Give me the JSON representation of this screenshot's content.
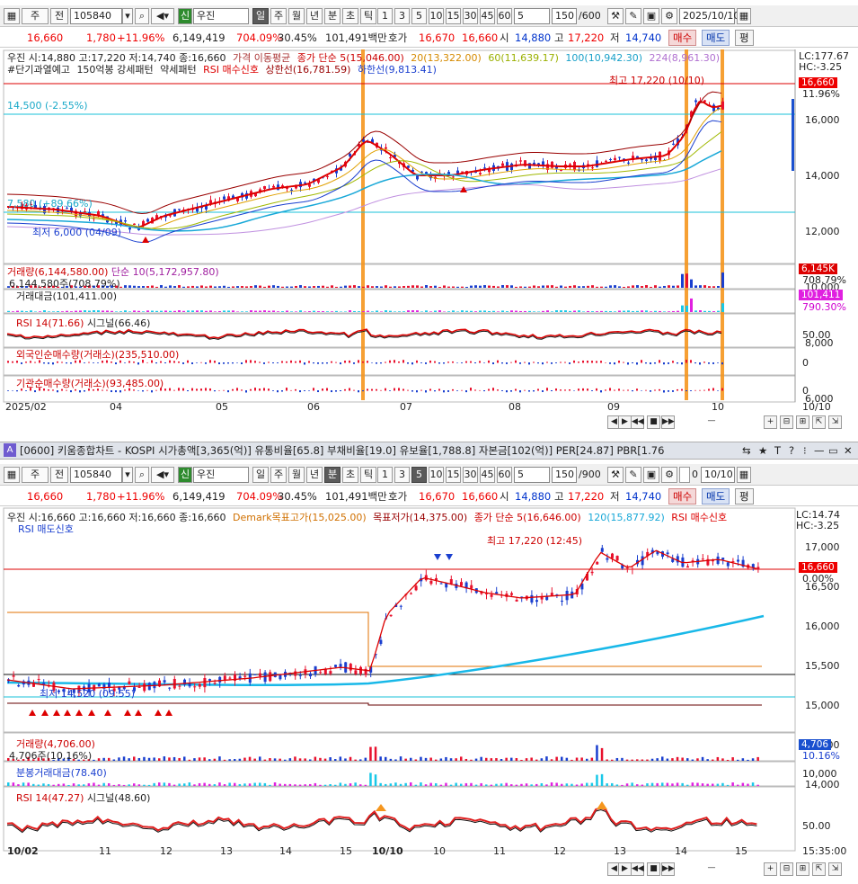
{
  "top": {
    "toolbar": {
      "type_code": "주",
      "prev_label": "전",
      "code": "105840",
      "stock_badge": "신",
      "stock_name": "우진",
      "periods": [
        "일",
        "주",
        "월",
        "년",
        "분",
        "초",
        "틱"
      ],
      "active_period": "일",
      "nums": [
        "1",
        "3",
        "5",
        "10",
        "15",
        "30",
        "45",
        "60"
      ],
      "count_value": "5",
      "range": "150",
      "range_total": "/600",
      "date": "2025/10/10"
    },
    "quote": {
      "price": "16,660",
      "change": "1,780",
      "change_pct": "+11.96%",
      "volume": "6,149,419",
      "vol_ratio": "704.09%",
      "turnover": "30.45%",
      "amount": "101,491백만",
      "hoga_label": "호가",
      "ask": "16,670",
      "bid": "16,660",
      "open_label": "시",
      "open": "14,880",
      "high_label": "고",
      "high": "17,220",
      "low_label": "저",
      "low": "14,740",
      "buy": "매수",
      "sell": "매도",
      "eval": "평"
    },
    "legend1": {
      "ohlc": "우진 시:14,880 고:17,220 저:14,740 종:16,660",
      "ma_title": "가격 이동평균",
      "ma5": "종가 단순 5(15,046.00)",
      "ma20": "20(13,322.00)",
      "ma60": "60(11,639.17)",
      "ma100": "100(10,942.30)",
      "ma224": "224(8,961.30)"
    },
    "legend2": {
      "warn": "#단기과열예고",
      "strong": "150억봉 강세패턴",
      "weak": "약세패턴",
      "rsi_signal": "RSI 매수신호",
      "upper": "상한선(16,781.59)",
      "lower": "하한선(9,813.41)"
    },
    "side": {
      "lc": "LC:177.67",
      "hc": "HC:-3.25",
      "price_tag": "16,660",
      "pct_tag": "11.96%"
    },
    "price_axis": [
      "16,000",
      "14,000",
      "12,000",
      "10,000",
      "8,000",
      "6,000"
    ],
    "annotations": {
      "high": "최고 17,220 (10/10)",
      "low": "최저 6,000 (04/09)",
      "ref_line": "14,500 (-2.55%)",
      "ref_line2": "7,580 (+89.66%)"
    },
    "volume": {
      "label": "거래량(6,144,580.00)",
      "ma": "단순 10(5,172,957.80)",
      "sub": "6,144,580주(708.79%)",
      "tag": "6,145K",
      "tag_pct": "708.79%"
    },
    "amount": {
      "label": "거래대금(101,411.00)",
      "tag": "101,411",
      "tag_pct": "790.30%"
    },
    "rsi": {
      "label": "RSI 14(71.66)",
      "signal": "시그널(66.46)",
      "axis": "50.00"
    },
    "foreign": {
      "label": "외국인순매수량(거래소)(235,510.00)",
      "axis": "0"
    },
    "inst": {
      "label": "기관순매수량(거래소)(93,485.00)",
      "axis": "0"
    },
    "xaxis": [
      "2025/02",
      "04",
      "05",
      "06",
      "07",
      "08",
      "09",
      "10"
    ],
    "xaxis_right": "10/10"
  },
  "window": {
    "badge": "A",
    "title": "[0600] 키움종합차트 - KOSPI 시가총액[3,365(억)] 유통비율[65.8] 부채비율[19.0] 유보율[1,788.8] 자본금[102(억)] PER[24.87] PBR[1.76"
  },
  "bottom": {
    "toolbar": {
      "type_code": "주",
      "prev_label": "전",
      "code": "105840",
      "stock_badge": "신",
      "stock_name": "우진",
      "periods": [
        "일",
        "주",
        "월",
        "년",
        "분",
        "초",
        "틱"
      ],
      "active_period": "분",
      "nums": [
        "1",
        "3",
        "5",
        "10",
        "15",
        "30",
        "45",
        "60"
      ],
      "active_num": "5",
      "count_value": "5",
      "range": "150",
      "range_total": "/900",
      "checkbox_value": "0",
      "date": "10/10"
    },
    "quote": {
      "price": "16,660",
      "change": "1,780",
      "change_pct": "+11.96%",
      "volume": "6,149,419",
      "vol_ratio": "704.09%",
      "turnover": "30.45%",
      "amount": "101,491백만",
      "hoga_label": "호가",
      "ask": "16,670",
      "bid": "16,660",
      "open_label": "시",
      "open": "14,880",
      "high_label": "고",
      "high": "17,220",
      "low_label": "저",
      "low": "14,740",
      "buy": "매수",
      "sell": "매도",
      "eval": "평"
    },
    "legend1": {
      "ohlc": "우진 시:16,660 고:16,660 저:16,660 종:16,660",
      "demark_high": "Demark목표고가(15,025.00)",
      "demark_low": "목표저가(14,375.00)",
      "ma5": "종가 단순 5(16,646.00)",
      "ma120": "120(15,877.92)",
      "rsi_buy": "RSI 매수신호",
      "rsi_sell": "RSI 매도신호"
    },
    "side": {
      "lc": "LC:14.74",
      "hc": "HC:-3.25",
      "price_tag": "16,660",
      "pct_tag": "0.00%"
    },
    "price_axis": [
      "17,000",
      "16,500",
      "16,000",
      "15,500",
      "15,000",
      "14,500",
      "14,000"
    ],
    "annotations": {
      "high": "최고 17,220 (12:45)",
      "low": "최저 14,520 (09:55)"
    },
    "volume": {
      "label": "거래량(4,706.00)",
      "sub": "4,706주(10.16%)",
      "tag": "4,706",
      "tag_pct": "10.16%"
    },
    "amount": {
      "label": "분봉거래대금(78.40)",
      "axis": "10,000"
    },
    "rsi": {
      "label": "RSI 14(47.27)",
      "signal": "시그널(48.60)",
      "axis": "50.00"
    },
    "xaxis": [
      "10/02",
      "11",
      "12",
      "13",
      "14",
      "15",
      "10/10",
      "10",
      "11",
      "12",
      "13",
      "14",
      "15"
    ],
    "xaxis_right": "15:35:00"
  },
  "colors": {
    "up": "#e8112d",
    "down": "#1a3fcf",
    "highlight": "#f5961e",
    "accent": "#cc0000"
  }
}
